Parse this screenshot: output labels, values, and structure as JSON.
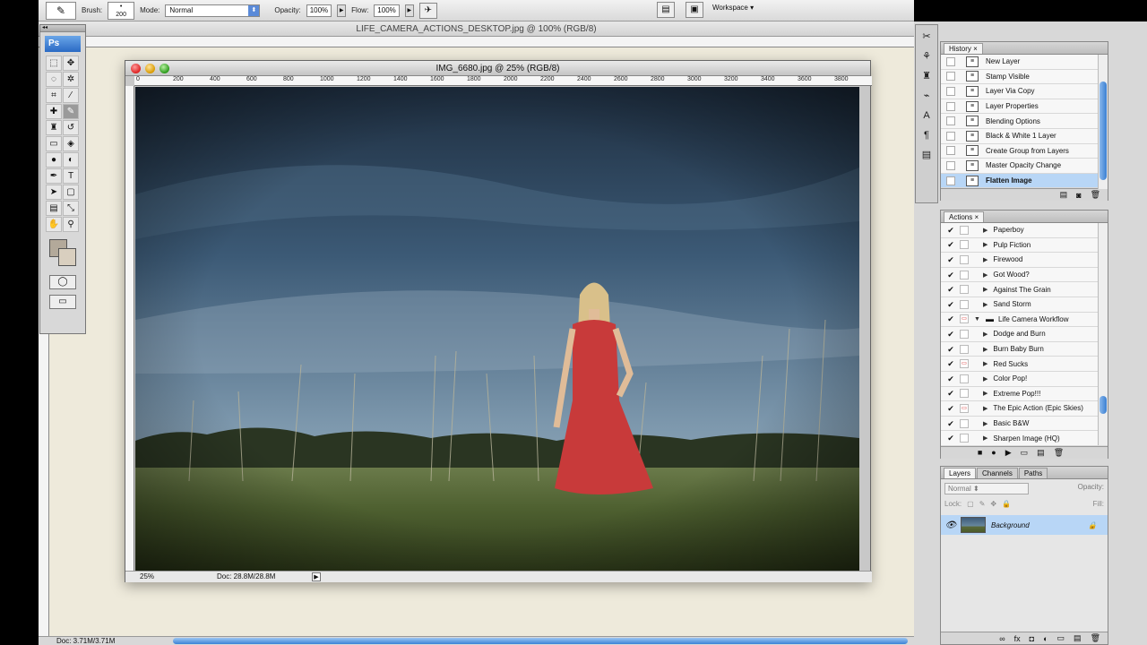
{
  "options_bar": {
    "brush_label": "Brush:",
    "brush_size": "200",
    "mode_label": "Mode:",
    "mode_value": "Normal",
    "opacity_label": "Opacity:",
    "opacity_value": "100%",
    "flow_label": "Flow:",
    "flow_value": "100%",
    "workspace_label": "Workspace"
  },
  "background_doc": {
    "title": "LIFE_CAMERA_ACTIONS_DESKTOP.jpg @ 100% (RGB/8)",
    "status_doc": "Doc: 3.71M/3.71M"
  },
  "tools": {
    "logo": "Ps"
  },
  "document": {
    "title": "IMG_6680.jpg @ 25% (RGB/8)",
    "zoom": "25%",
    "doc_info": "Doc: 28.8M/28.8M",
    "ruler_h": [
      "0",
      "200",
      "400",
      "600",
      "800",
      "1000",
      "1200",
      "1400",
      "1600",
      "1800",
      "2000",
      "2200",
      "2400",
      "2600",
      "2800",
      "3000",
      "3200",
      "3400",
      "3600",
      "3800"
    ]
  },
  "history": {
    "tab": "History",
    "items": [
      {
        "label": "New Layer"
      },
      {
        "label": "Stamp Visible"
      },
      {
        "label": "Layer Via Copy"
      },
      {
        "label": "Layer Properties"
      },
      {
        "label": "Blending Options"
      },
      {
        "label": "Black & White 1 Layer"
      },
      {
        "label": "Create Group from Layers"
      },
      {
        "label": "Master Opacity Change"
      },
      {
        "label": "Flatten Image",
        "selected": true
      }
    ]
  },
  "actions": {
    "tab": "Actions",
    "items": [
      {
        "label": "Paperboy",
        "modal": false,
        "type": "action"
      },
      {
        "label": "Pulp Fiction",
        "modal": false,
        "type": "action"
      },
      {
        "label": "Firewood",
        "modal": false,
        "type": "action"
      },
      {
        "label": "Got Wood?",
        "modal": false,
        "type": "action"
      },
      {
        "label": "Against The Grain",
        "modal": false,
        "type": "action"
      },
      {
        "label": "Sand Storm",
        "modal": false,
        "type": "action"
      },
      {
        "label": "Life Camera Workflow",
        "modal": true,
        "type": "set"
      },
      {
        "label": "Dodge and Burn",
        "modal": false,
        "type": "action"
      },
      {
        "label": "Burn Baby Burn",
        "modal": false,
        "type": "action"
      },
      {
        "label": "Red Sucks",
        "modal": true,
        "type": "action"
      },
      {
        "label": "Color Pop!",
        "modal": false,
        "type": "action"
      },
      {
        "label": "Extreme Pop!!!",
        "modal": false,
        "type": "action"
      },
      {
        "label": "The Epic Action (Epic Skies)",
        "modal": true,
        "type": "action"
      },
      {
        "label": "Basic B&W",
        "modal": false,
        "type": "action"
      },
      {
        "label": "Sharpen Image (HQ)",
        "modal": false,
        "type": "action"
      }
    ]
  },
  "layers": {
    "tabs": [
      "Layers",
      "Channels",
      "Paths"
    ],
    "blend_mode": "Normal",
    "opacity_label": "Opacity:",
    "lock_label": "Lock:",
    "fill_label": "Fill:",
    "items": [
      {
        "label": "Background",
        "selected": true
      }
    ]
  }
}
